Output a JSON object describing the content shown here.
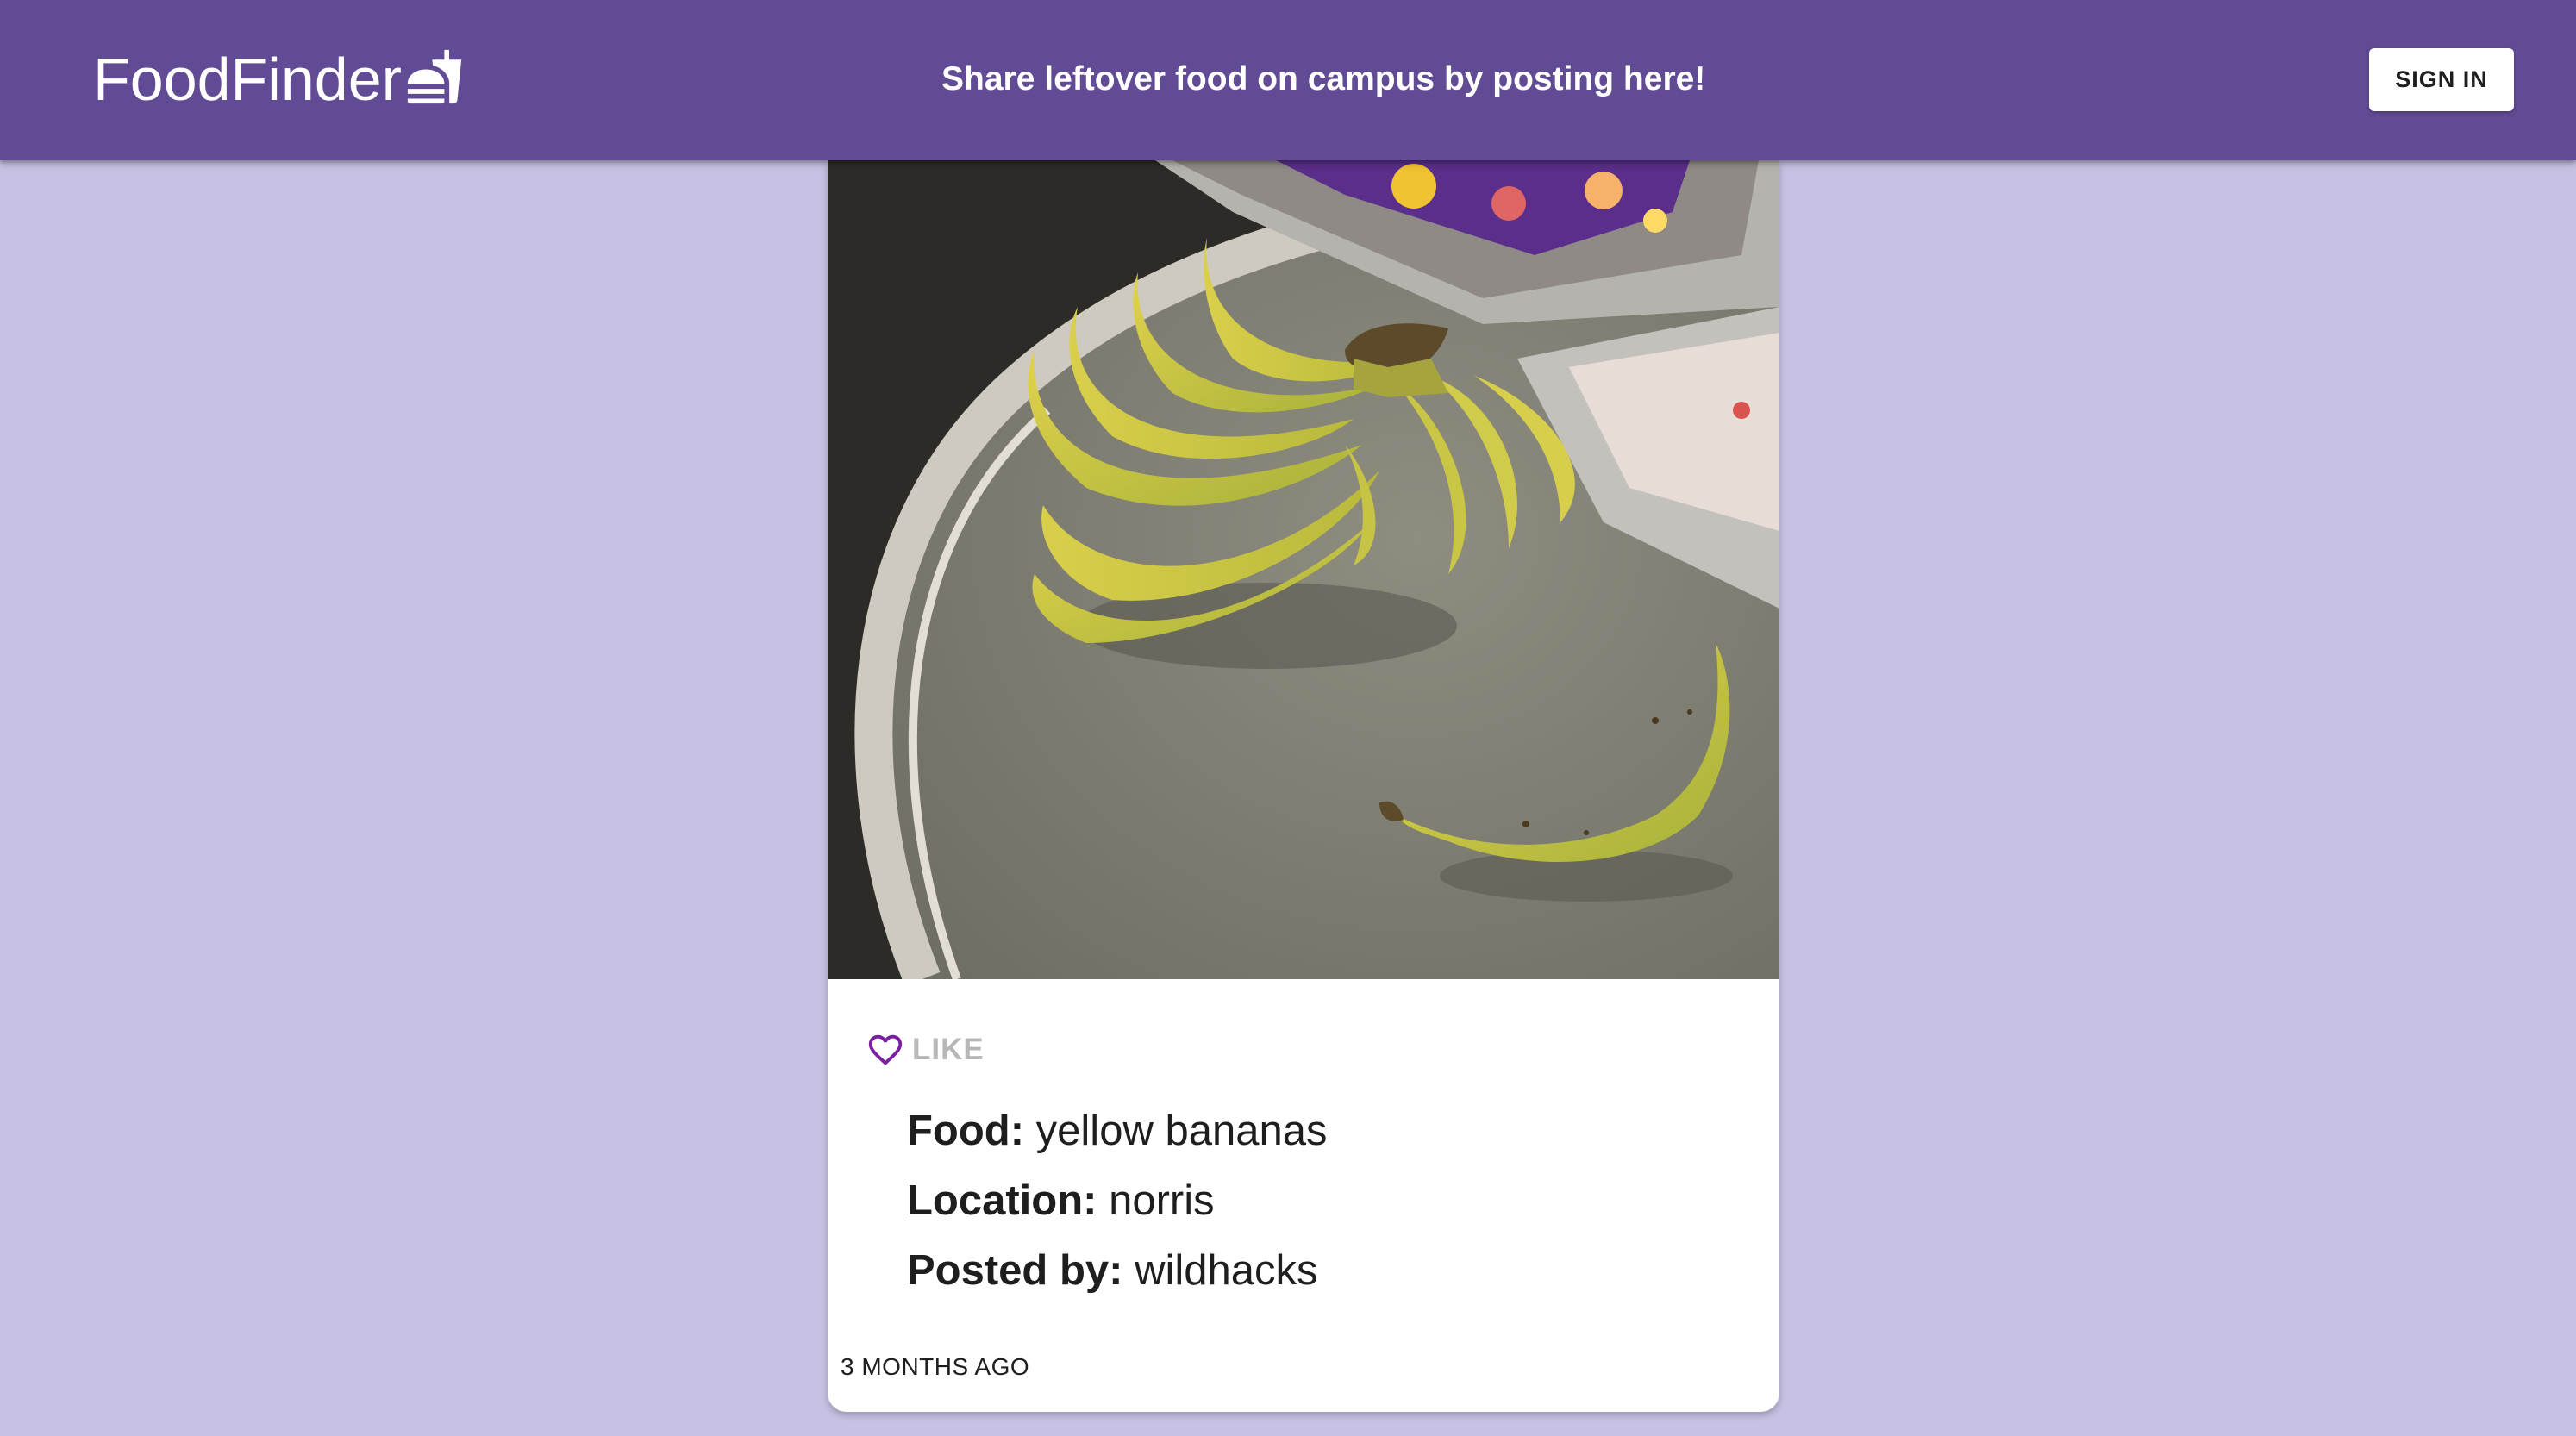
{
  "header": {
    "brand": "FoodFinder",
    "brand_icon": "fastfood-icon",
    "tagline": "Share leftover food on campus by posting here!",
    "sign_in_label": "SIGN IN",
    "bar_color": "#624b95"
  },
  "page": {
    "background_color": "#c7c1e3"
  },
  "post": {
    "image": "photo of a bunch of yellow bananas and a single banana on a gray table next to foil trays",
    "like_icon": "heart-outline-icon",
    "like_label": "LIKE",
    "like_icon_color": "#7b1fa2",
    "fields": [
      {
        "label": "Food:",
        "value": "yellow bananas"
      },
      {
        "label": "Location:",
        "value": "norris"
      },
      {
        "label": "Posted by:",
        "value": "wildhacks"
      }
    ],
    "timestamp": "3 MONTHS AGO"
  }
}
